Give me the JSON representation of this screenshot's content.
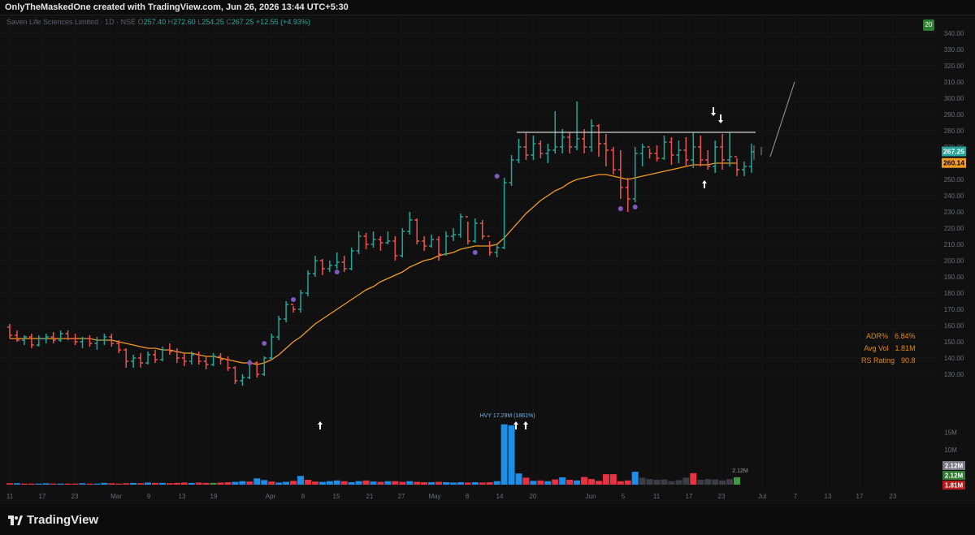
{
  "header": {
    "credit": "OnlyTheMaskedOne created with TradingView.com, Jun 26, 2026 13:44 UTC+5:30"
  },
  "legend": {
    "symbol": "Saven Life Sciences Limited · 1D · NSE",
    "o_label": "O",
    "o": "257.40",
    "h_label": "H",
    "h": "272.60",
    "l_label": "L",
    "l": "254.25",
    "c_label": "C",
    "c": "267.25",
    "change": "+12.55 (+4.93%)"
  },
  "timeframe_badge": "20",
  "stats": {
    "adr_label": "ADR%",
    "adr": "6.84%",
    "avgvol_label": "Avg Vol",
    "avgvol": "1.81M",
    "rs_label": "RS Rating",
    "rs": "90.8"
  },
  "footer": {
    "logo_text": "TradingView"
  },
  "colors": {
    "up": "#26a69a",
    "down": "#ef5350",
    "ma": "#f29b24",
    "vol_up": "#2196f3",
    "vol_down": "#f23645",
    "vol_neutral": "#3a3d45",
    "marker": "#7e57c2",
    "resistance": "#d0d0d0"
  },
  "chart_data": {
    "type": "ohlc",
    "price_axis": {
      "ticks": [
        130,
        140,
        150,
        160,
        170,
        180,
        190,
        200,
        210,
        220,
        230,
        240,
        250,
        260,
        270,
        280,
        290,
        300,
        310,
        320,
        330,
        340
      ],
      "labels": [
        "130.00",
        "140.00",
        "150.00",
        "160.00",
        "170.00",
        "180.00",
        "190.00",
        "200.00",
        "210.00",
        "220.00",
        "230.00",
        "240.00",
        "250.00",
        "260.00",
        "270.00",
        "280.00",
        "290.00",
        "300.00",
        "310.00",
        "320.00",
        "330.00",
        "340.00"
      ],
      "ylim": [
        120,
        345
      ]
    },
    "time_axis": {
      "labels": [
        "11",
        "17",
        "23",
        "Mar",
        "9",
        "13",
        "19",
        "Apr",
        "8",
        "15",
        "21",
        "27",
        "May",
        "8",
        "14",
        "20",
        "Jun",
        "5",
        "11",
        "17",
        "23",
        "Jul",
        "7",
        "13",
        "17",
        "23"
      ]
    },
    "last_price": {
      "value": 267.25,
      "label": "267.25"
    },
    "ma_last": {
      "value": 260.14,
      "label": "260.14"
    },
    "volume_axis": {
      "labels": [
        "15M",
        "10M"
      ],
      "values": [
        15,
        10
      ]
    },
    "volume_badges": [
      {
        "label": "2.12M",
        "kind": "neutral"
      },
      {
        "label": "2.12M",
        "kind": "up"
      },
      {
        "label": "1.81M",
        "kind": "down"
      }
    ],
    "hvy_label": "HVY 17.29M (1861%)",
    "vol_last_label": "2.12M",
    "resistance_level": 279,
    "bars": [
      [
        159,
        161,
        152,
        154
      ],
      [
        154,
        157,
        150,
        151
      ],
      [
        151,
        154,
        148,
        153
      ],
      [
        153,
        155,
        146,
        148
      ],
      [
        148,
        154,
        147,
        152
      ],
      [
        152,
        155,
        149,
        153
      ],
      [
        153,
        156,
        149,
        151
      ],
      [
        151,
        157,
        150,
        155
      ],
      [
        155,
        157,
        151,
        152
      ],
      [
        152,
        155,
        148,
        150
      ],
      [
        150,
        153,
        146,
        152
      ],
      [
        152,
        154,
        147,
        149
      ],
      [
        149,
        153,
        145,
        151
      ],
      [
        151,
        155,
        148,
        153
      ],
      [
        153,
        155,
        147,
        149
      ],
      [
        149,
        151,
        143,
        145
      ],
      [
        145,
        146,
        134,
        138
      ],
      [
        138,
        142,
        134,
        140
      ],
      [
        140,
        143,
        134,
        137
      ],
      [
        137,
        144,
        136,
        142
      ],
      [
        142,
        145,
        137,
        139
      ],
      [
        139,
        147,
        138,
        145
      ],
      [
        145,
        149,
        142,
        144
      ],
      [
        144,
        146,
        137,
        140
      ],
      [
        140,
        143,
        135,
        138
      ],
      [
        138,
        144,
        136,
        142
      ],
      [
        142,
        144,
        136,
        138
      ],
      [
        138,
        141,
        133,
        136
      ],
      [
        136,
        143,
        135,
        141
      ],
      [
        141,
        143,
        136,
        139
      ],
      [
        139,
        141,
        132,
        134
      ],
      [
        134,
        135,
        124,
        126
      ],
      [
        126,
        130,
        123,
        128
      ],
      [
        128,
        139,
        127,
        137
      ],
      [
        137,
        138,
        128,
        130
      ],
      [
        130,
        141,
        129,
        140
      ],
      [
        140,
        155,
        139,
        153
      ],
      [
        153,
        166,
        151,
        164
      ],
      [
        164,
        175,
        162,
        173
      ],
      [
        173,
        172,
        168,
        170
      ],
      [
        170,
        182,
        168,
        180
      ],
      [
        180,
        194,
        178,
        192
      ],
      [
        192,
        203,
        190,
        200
      ],
      [
        200,
        201,
        191,
        195
      ],
      [
        195,
        200,
        193,
        197
      ],
      [
        197,
        205,
        195,
        199
      ],
      [
        199,
        203,
        193,
        195
      ],
      [
        195,
        208,
        194,
        206
      ],
      [
        206,
        218,
        204,
        215
      ],
      [
        215,
        217,
        207,
        210
      ],
      [
        210,
        218,
        208,
        213
      ],
      [
        213,
        215,
        206,
        211
      ],
      [
        211,
        218,
        210,
        212
      ],
      [
        212,
        215,
        200,
        203
      ],
      [
        203,
        220,
        202,
        218
      ],
      [
        218,
        230,
        216,
        225
      ],
      [
        225,
        226,
        210,
        212
      ],
      [
        212,
        215,
        206,
        209
      ],
      [
        209,
        216,
        208,
        213
      ],
      [
        213,
        215,
        200,
        204
      ],
      [
        204,
        218,
        203,
        215
      ],
      [
        215,
        220,
        212,
        216
      ],
      [
        216,
        229,
        214,
        227
      ],
      [
        227,
        224,
        210,
        212
      ],
      [
        212,
        226,
        211,
        223
      ],
      [
        223,
        225,
        213,
        215
      ],
      [
        215,
        212,
        203,
        205
      ],
      [
        205,
        210,
        202,
        208
      ],
      [
        208,
        251,
        207,
        248
      ],
      [
        248,
        265,
        246,
        262
      ],
      [
        262,
        275,
        260,
        270
      ],
      [
        270,
        279,
        262,
        265
      ],
      [
        265,
        277,
        262,
        272
      ],
      [
        272,
        274,
        263,
        266
      ],
      [
        266,
        272,
        260,
        268
      ],
      [
        268,
        292,
        266,
        270
      ],
      [
        270,
        281,
        266,
        276
      ],
      [
        276,
        279,
        266,
        270
      ],
      [
        270,
        298,
        268,
        275
      ],
      [
        275,
        281,
        266,
        270
      ],
      [
        270,
        287,
        267,
        283
      ],
      [
        283,
        284,
        264,
        272
      ],
      [
        272,
        278,
        258,
        268
      ],
      [
        268,
        270,
        253,
        256
      ],
      [
        256,
        268,
        238,
        245
      ],
      [
        245,
        251,
        230,
        238
      ],
      [
        238,
        270,
        236,
        266
      ],
      [
        266,
        272,
        258,
        270
      ],
      [
        270,
        269,
        263,
        266
      ],
      [
        266,
        271,
        261,
        263
      ],
      [
        263,
        277,
        262,
        273
      ],
      [
        273,
        276,
        259,
        265
      ],
      [
        265,
        274,
        260,
        268
      ],
      [
        268,
        276,
        258,
        262
      ],
      [
        262,
        279,
        257,
        270
      ],
      [
        270,
        277,
        258,
        262
      ],
      [
        262,
        268,
        256,
        258
      ],
      [
        258,
        274,
        254,
        270
      ],
      [
        270,
        278,
        256,
        262
      ],
      [
        262,
        279,
        258,
        264
      ],
      [
        264,
        263,
        252,
        256
      ],
      [
        256,
        261,
        252,
        258
      ],
      [
        258,
        272,
        254,
        267
      ]
    ],
    "ma": [
      152,
      152,
      152,
      152,
      152,
      152,
      152,
      152,
      152,
      152,
      152,
      152,
      151,
      151,
      151,
      150,
      149,
      148,
      147,
      146,
      146,
      145,
      145,
      144,
      143,
      143,
      142,
      141,
      141,
      140,
      139,
      138,
      137,
      137,
      136,
      137,
      139,
      142,
      146,
      150,
      153,
      157,
      161,
      164,
      167,
      170,
      173,
      176,
      179,
      182,
      184,
      187,
      189,
      191,
      193,
      196,
      198,
      200,
      201,
      203,
      204,
      205,
      207,
      208,
      209,
      209,
      209,
      210,
      214,
      219,
      224,
      229,
      233,
      237,
      240,
      243,
      245,
      248,
      250,
      251,
      252,
      253,
      253,
      252,
      251,
      250,
      251,
      252,
      253,
      254,
      255,
      256,
      257,
      258,
      259,
      259,
      259,
      260,
      260,
      260,
      260
    ],
    "volume": [
      0.4,
      0.4,
      0.3,
      0.3,
      0.3,
      0.4,
      0.3,
      0.3,
      0.3,
      0.3,
      0.4,
      0.3,
      0.3,
      0.5,
      0.4,
      0.3,
      0.4,
      0.5,
      0.4,
      0.6,
      0.5,
      0.5,
      0.4,
      0.5,
      0.6,
      0.5,
      0.6,
      0.5,
      0.5,
      0.6,
      0.7,
      0.8,
      1.0,
      0.9,
      1.8,
      1.3,
      0.9,
      0.6,
      0.8,
      1.1,
      2.5,
      1.4,
      0.9,
      0.8,
      1.0,
      1.2,
      1.0,
      0.7,
      1.0,
      1.2,
      0.9,
      0.8,
      1.0,
      1.0,
      0.8,
      1.0,
      0.8,
      0.7,
      0.7,
      0.8,
      0.7,
      0.6,
      0.7,
      0.6,
      0.7,
      0.6,
      0.7,
      1.0,
      17.29,
      17.0,
      3.2,
      2.0,
      1.1,
      1.2,
      1.0,
      1.5,
      2.1,
      1.4,
      1.2,
      2.2,
      1.6,
      1.1,
      3.0,
      3.0,
      1.0,
      1.2,
      3.7,
      2.0,
      1.6,
      1.4,
      1.5,
      1.0,
      1.3,
      2.0,
      3.3,
      1.4,
      1.6,
      1.5,
      1.2,
      1.6,
      2.12
    ],
    "volume_kind": [
      "d",
      "u",
      "d",
      "d",
      "u",
      "u",
      "d",
      "u",
      "d",
      "d",
      "u",
      "d",
      "u",
      "u",
      "d",
      "d",
      "d",
      "u",
      "d",
      "u",
      "d",
      "u",
      "d",
      "d",
      "d",
      "u",
      "d",
      "d",
      "g",
      "d",
      "d",
      "u",
      "u",
      "d",
      "u",
      "u",
      "d",
      "u",
      "u",
      "d",
      "u",
      "d",
      "d",
      "u",
      "u",
      "u",
      "d",
      "u",
      "u",
      "d",
      "u",
      "d",
      "u",
      "d",
      "d",
      "u",
      "d",
      "d",
      "u",
      "d",
      "u",
      "u",
      "u",
      "d",
      "u",
      "d",
      "d",
      "u",
      "u",
      "u",
      "u",
      "d",
      "u",
      "d",
      "u",
      "d",
      "u",
      "d",
      "u",
      "d",
      "d",
      "d",
      "d",
      "d",
      "d",
      "d",
      "u",
      "n",
      "n",
      "n",
      "n",
      "n",
      "n",
      "n",
      "d",
      "n",
      "n",
      "n",
      "n",
      "n",
      "g"
    ],
    "markers_below": [
      {
        "bar": 33,
        "price": 137
      },
      {
        "bar": 35,
        "price": 149
      },
      {
        "bar": 39,
        "price": 176
      },
      {
        "bar": 45,
        "price": 193
      },
      {
        "bar": 64,
        "price": 205
      },
      {
        "bar": 67,
        "price": 252
      },
      {
        "bar": 84,
        "price": 232
      },
      {
        "bar": 86,
        "price": 233
      }
    ]
  }
}
